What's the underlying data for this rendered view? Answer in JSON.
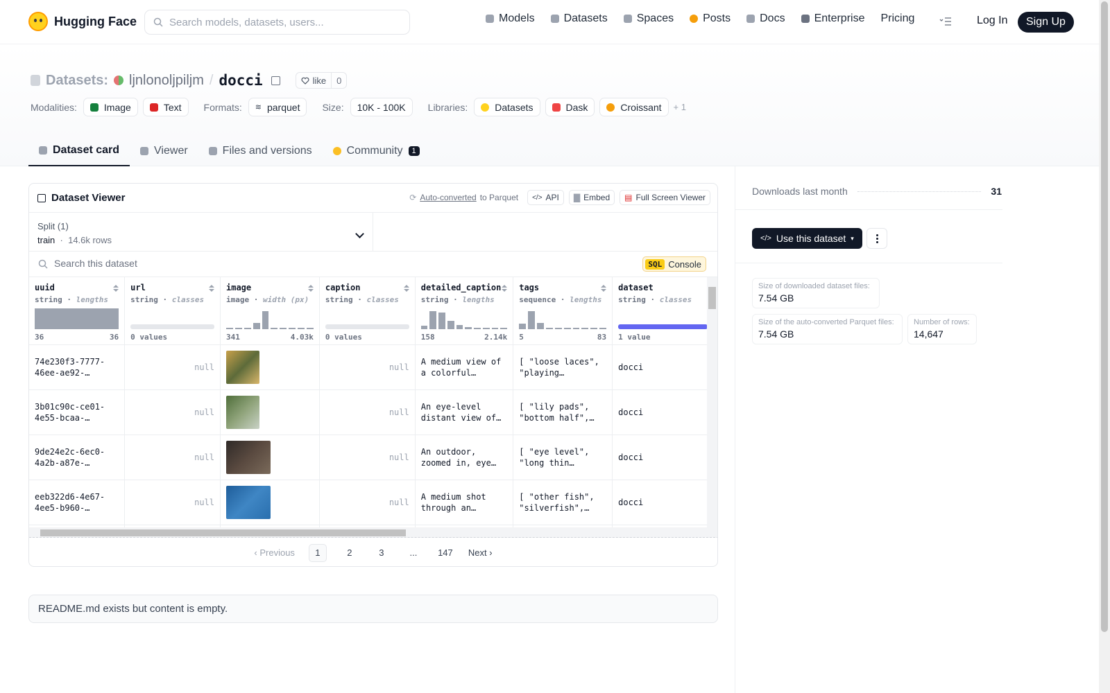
{
  "nav": {
    "brand": "Hugging Face",
    "search_placeholder": "Search models, datasets, users...",
    "links": [
      {
        "label": "Models",
        "icon": "cube-icon",
        "color": "#9ca3af"
      },
      {
        "label": "Datasets",
        "icon": "database-icon",
        "color": "#9ca3af"
      },
      {
        "label": "Spaces",
        "icon": "grid-icon",
        "color": "#9ca3af"
      },
      {
        "label": "Posts",
        "icon": "chat-icon",
        "color": "#f59e0b"
      },
      {
        "label": "Docs",
        "icon": "doc-icon",
        "color": "#9ca3af"
      },
      {
        "label": "Enterprise",
        "icon": "enterprise-icon",
        "color": "#6b7280"
      },
      {
        "label": "Pricing",
        "icon": "",
        "color": ""
      }
    ],
    "login": "Log In",
    "signup": "Sign Up"
  },
  "dataset": {
    "section": "Datasets:",
    "owner": "ljnlonoljpiljm",
    "name": "docci",
    "like_label": "like",
    "like_count": "0"
  },
  "meta": {
    "modalities_label": "Modalities:",
    "modalities": [
      "Image",
      "Text"
    ],
    "formats_label": "Formats:",
    "format": "parquet",
    "size_label": "Size:",
    "size": "10K - 100K",
    "libraries_label": "Libraries:",
    "libraries": [
      "Datasets",
      "Dask",
      "Croissant"
    ],
    "libraries_more": "+ 1"
  },
  "tabs": [
    {
      "label": "Dataset card",
      "active": true
    },
    {
      "label": "Viewer",
      "active": false
    },
    {
      "label": "Files and versions",
      "active": false
    },
    {
      "label": "Community",
      "active": false,
      "badge": "1"
    }
  ],
  "viewer": {
    "title": "Dataset Viewer",
    "auto_converted": "Auto-converted",
    "to_parquet": "to Parquet",
    "api_label": "API",
    "embed_label": "Embed",
    "fullscreen_label": "Full Screen Viewer",
    "split_label": "Split (1)",
    "split_name": "train",
    "split_rows": "14.6k rows",
    "search_placeholder": "Search this dataset",
    "sql_tag": "SQL",
    "console_label": "Console",
    "columns": [
      {
        "name": "uuid",
        "type": "string",
        "sub": "lengths",
        "min": "36",
        "max": "36",
        "hist": "full"
      },
      {
        "name": "url",
        "type": "string",
        "sub": "classes",
        "min": "0 values",
        "max": "",
        "hist": "empty"
      },
      {
        "name": "image",
        "type": "image",
        "sub": "width (px)",
        "min": "341",
        "max": "4.03k",
        "hist": [
          0.05,
          0.05,
          0.05,
          0.3,
          0.85,
          0.05,
          0.05,
          0.05,
          0.05,
          0.05
        ]
      },
      {
        "name": "caption",
        "type": "string",
        "sub": "classes",
        "min": "0 values",
        "max": "",
        "hist": "empty"
      },
      {
        "name": "detailed_caption",
        "type": "string",
        "sub": "lengths",
        "min": "158",
        "max": "2.14k",
        "hist": [
          0.15,
          0.85,
          0.8,
          0.4,
          0.2,
          0.08,
          0.05,
          0.05,
          0.05,
          0.05
        ]
      },
      {
        "name": "tags",
        "type": "sequence",
        "sub": "lengths",
        "min": "5",
        "max": "83",
        "hist": [
          0.25,
          0.85,
          0.3,
          0.05,
          0.05,
          0.05,
          0.05,
          0.05,
          0.05,
          0.05
        ]
      },
      {
        "name": "dataset",
        "type": "string",
        "sub": "classes",
        "min": "1 value",
        "max": "",
        "hist": "blue"
      }
    ],
    "rows": [
      {
        "uuid": "74e230f3-7777-46ee-ae92-…",
        "url": "null",
        "image": {
          "w": "narrow",
          "colors": [
            "#c8a04a",
            "#5d6b3a",
            "#d9b66a"
          ]
        },
        "caption": "null",
        "detailed_caption": "A medium view of a colorful cartoon…",
        "tags": "[ \"loose laces\", \"playing guitar\",…",
        "dataset": "docci"
      },
      {
        "uuid": "3b01c90c-ce01-4e55-bcaa-…",
        "url": "null",
        "image": {
          "w": "narrow",
          "colors": [
            "#4f6e3a",
            "#8fa37a",
            "#c9d2c6"
          ]
        },
        "caption": "null",
        "detailed_caption": "An eye-level distant view of a…",
        "tags": "[ \"lily pads\", \"bottom half\", \"n…",
        "dataset": "docci"
      },
      {
        "uuid": "9de24e2c-6ec0-4a2b-a87e-…",
        "url": "null",
        "image": {
          "w": "wide",
          "colors": [
            "#2f2a28",
            "#5a4a40",
            "#7a6a5a"
          ]
        },
        "caption": "null",
        "detailed_caption": "An outdoor, zoomed in, eye level vie…",
        "tags": "[ \"eye level\", \"long thin…",
        "dataset": "docci"
      },
      {
        "uuid": "eeb322d6-4e67-4ee5-b960-…",
        "url": "null",
        "image": {
          "w": "wide",
          "colors": [
            "#1e5d9a",
            "#3f86c4",
            "#2a6fae"
          ]
        },
        "caption": "null",
        "detailed_caption": "A medium shot through an…",
        "tags": "[ \"other fish\", \"silverfish\",…",
        "dataset": "docci"
      }
    ],
    "pager": {
      "prev": "Previous",
      "pages": [
        "1",
        "2",
        "3",
        "...",
        "147"
      ],
      "next": "Next"
    }
  },
  "readme": "README.md exists but content is empty.",
  "sidebar": {
    "downloads_label": "Downloads last month",
    "downloads_value": "31",
    "use_button": "Use this dataset",
    "stats": [
      {
        "key": "Size of downloaded dataset files:",
        "value": "7.54 GB"
      },
      {
        "key": "Size of the auto-converted Parquet files:",
        "value": "7.54 GB"
      },
      {
        "key": "Number of rows:",
        "value": "14,647"
      }
    ]
  }
}
